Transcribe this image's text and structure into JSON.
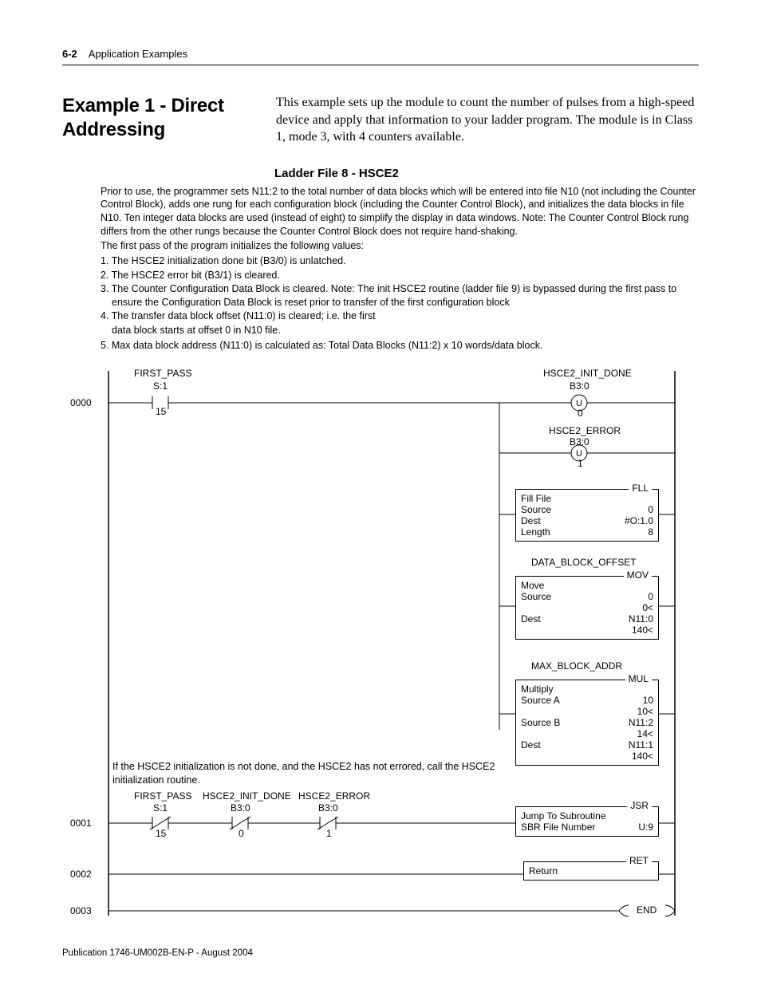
{
  "header": {
    "page_number": "6-2",
    "chapter_title": "Application Examples"
  },
  "section": {
    "title": "Example 1 - Direct Addressing",
    "intro": "This example sets up the module to count the number of pulses from a high-speed device and apply that information to your ladder program. The module is in Class 1, mode 3, with 4 counters available."
  },
  "ladder": {
    "title": "Ladder File 8 - HSCE2",
    "desc_p1": "Prior to use, the programmer sets N11:2 to the total number of data blocks which will be entered into file N10 (not including the Counter Control Block), adds one rung for each configuration block (including the Counter Control Block), and initializes the data blocks in file N10. Ten integer data blocks are used (instead of eight) to simplify the display in data windows. Note: The Counter Control Block rung differs from the other rungs because the Counter Control Block does not require hand-shaking.",
    "desc_p2": "The first pass of the program initializes the following values:",
    "list1": "1. The HSCE2 initialization done bit (B3/0) is unlatched.",
    "list2": "2. The HSCE2 error bit (B3/1) is cleared.",
    "list3": "3. The Counter Configuration Data Block is cleared. Note: The init HSCE2 routine (ladder file 9) is bypassed during the first pass to ensure the Configuration Data Block is reset prior to transfer of the first configuration block",
    "list4": "4. The transfer data block offset (N11:0) is cleared; i.e. the first",
    "list4b": "data block starts at offset 0 in N10 file.",
    "list5": "5. Max data block address (N11:0) is calculated as: Total Data Blocks (N11:2) x 10 words/data block."
  },
  "diagram": {
    "rung_0000": "0000",
    "rung_0001": "0001",
    "rung_0002": "0002",
    "rung_0003": "0003",
    "first_pass": "FIRST_PASS",
    "s1": "S:1",
    "n15": "15",
    "hsce2_init_done": "HSCE2_INIT_DONE",
    "b30": "B3:0",
    "u": "U",
    "n0": "0",
    "hsce2_error": "HSCE2_ERROR",
    "n1": "1",
    "fll": "FLL",
    "fll_name": "Fill File",
    "source": "Source",
    "dest": "Dest",
    "length": "Length",
    "fll_source_v": "0",
    "fll_dest_v": "#O:1.0",
    "fll_length_v": "8",
    "data_block_offset": "DATA_BLOCK_OFFSET",
    "mov": "MOV",
    "move": "Move",
    "mov_source_v": "0",
    "mov_source_v2": "0<",
    "mov_dest_v": "N11:0",
    "mov_dest_v2": "140<",
    "max_block_addr": "MAX_BLOCK_ADDR",
    "mul": "MUL",
    "multiply": "Multiply",
    "source_a": "Source A",
    "source_b": "Source B",
    "mul_sa_v": "10",
    "mul_sa_v2": "10<",
    "mul_sb_v": "N11:2",
    "mul_sb_v2": "14<",
    "mul_dest_v": "N11:1",
    "mul_dest_v2": "140<",
    "rung1_comment": "If the HSCE2 initialization is not done, and the HSCE2 has not errored, call the HSCE2 initialization routine.",
    "jsr": "JSR",
    "jsr_name": "Jump To Subroutine",
    "sbr_file": "SBR File Number",
    "sbr_file_v": "U:9",
    "ret": "RET",
    "return": "Return",
    "end": "END"
  },
  "footer": "Publication 1746-UM002B-EN-P - August 2004"
}
